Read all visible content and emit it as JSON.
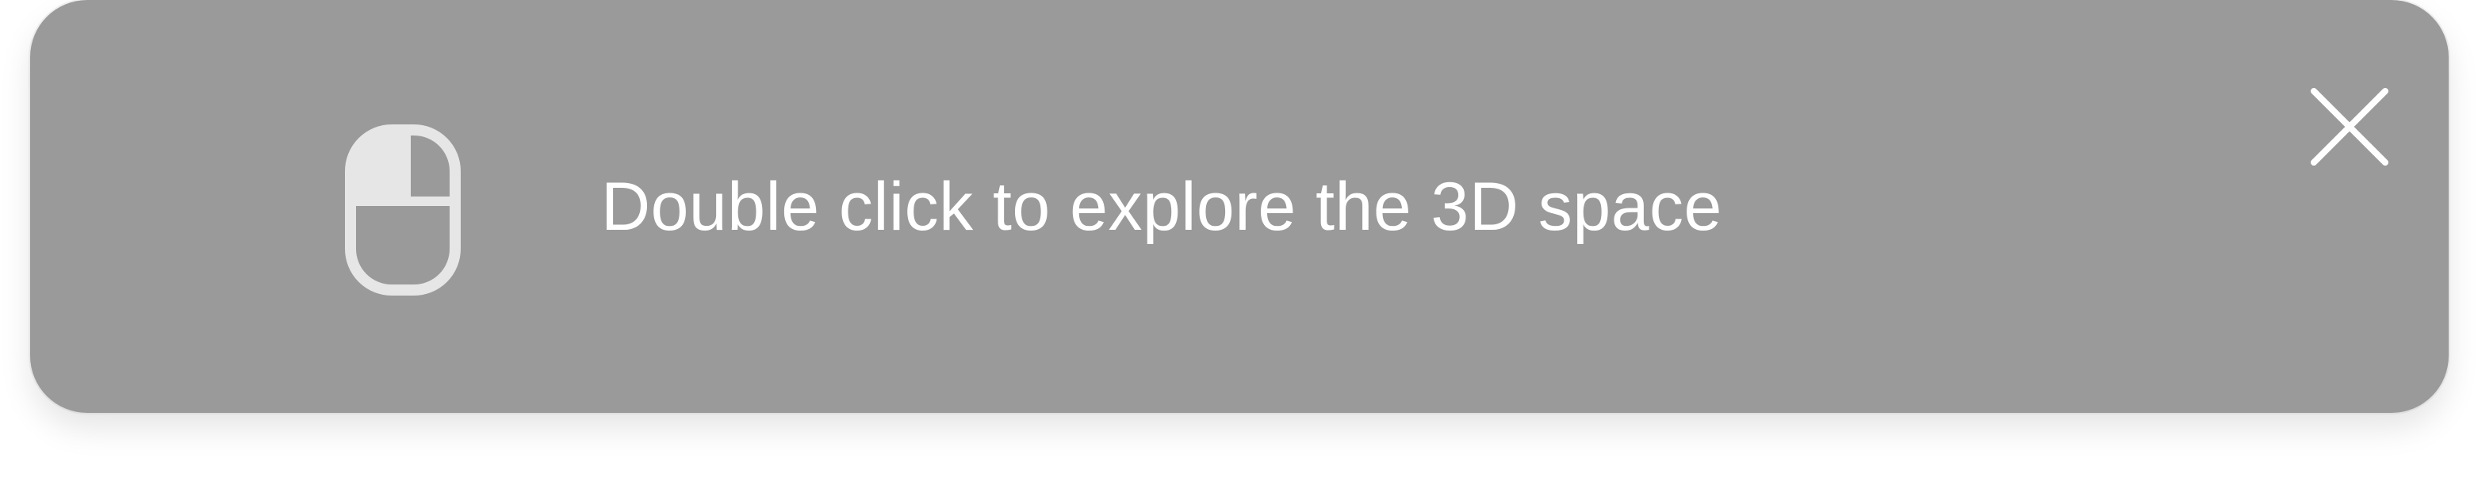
{
  "toast": {
    "message": "Double click to explore the 3D space",
    "icon": "mouse-icon",
    "close_icon": "close-icon"
  },
  "colors": {
    "toast_background": "#9a9a9a",
    "text": "#ffffff",
    "icon_fill": "#e6e6e6"
  }
}
